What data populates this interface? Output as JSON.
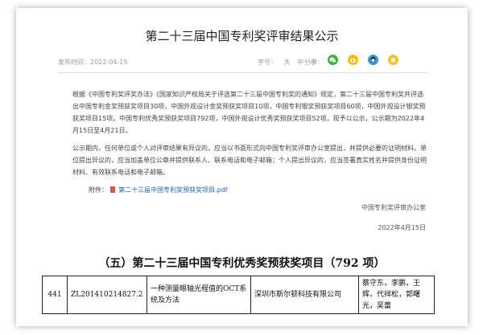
{
  "page": {
    "title": "第二十三届中国专利奖评审结果公示",
    "publish_label": "发布时间：2022-04-15",
    "font_size_label": "字号：",
    "font_sizes": [
      "大",
      "中",
      "小"
    ],
    "share_label": "分享：",
    "share_icons": [
      "wechat-icon",
      "weibo-icon",
      "qq-icon",
      "qzone-icon"
    ],
    "para1": "根据《中国专利奖评奖办法》《国家知识产权局关于评选第二十三届中国专利奖的通知》规定，第二十三届中国专利奖共评选出中国专利金奖预获奖项目30项，中国外观设计金奖预获奖项目10项，中国专利银奖预获奖项目60项，中国外观设计银奖预获奖项目15项，中国专利优秀奖预获奖项目792项，中国外观设计优秀奖预获奖项目52项，现予以公示，公示期为2022年4月15日至4月21日。",
    "para2": "公示期内，任何单位或个人对评审结果有异议的，应当以书面形式向中国专利奖评审办公室提出，并提供必要的证明材料。单位提出异议的，应当加盖单位公章并提供联系人、联系电话和电子邮箱；个人提出异议的，应当签署真实姓名并提供身份证明材料、有效联系电话和电子邮箱。",
    "attachment_label": "附件：",
    "attachment_link": "第二十三届中国专利奖预获奖项目.pdf",
    "org": "中国专利奖评审办公室",
    "date": "2022年4月15日"
  },
  "document": {
    "heading": "（五）第二十三届中国专利优秀奖预获奖项目（792 项）",
    "row": {
      "no": "441",
      "patent": "ZL201410214827.2",
      "name": "一种测量眼轴光程值的OCT系统及方法",
      "company": "深圳市斯尔顿科技有限公司",
      "inventors": "蔡守东，李鹏，王辉，代祥松，郭曙光，吴蕾"
    }
  }
}
